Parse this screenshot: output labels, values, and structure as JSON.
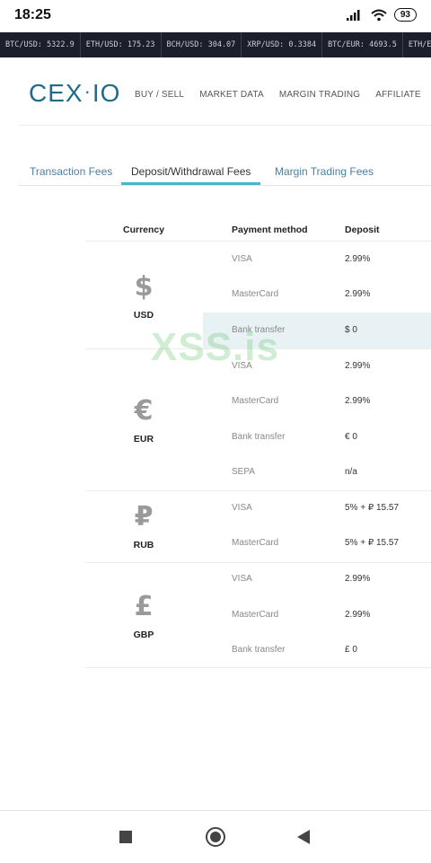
{
  "status_bar": {
    "time": "18:25",
    "battery": "93"
  },
  "ticker": [
    "BTC/USD: 5322.9",
    "ETH/USD: 175.23",
    "BCH/USD: 304.07",
    "XRP/USD: 0.3384",
    "BTC/EUR: 4693.5",
    "ETH/EUR"
  ],
  "header": {
    "logo_left": "CEX",
    "logo_dot": "·",
    "logo_right": "IO",
    "nav": [
      "BUY / SELL",
      "MARKET DATA",
      "MARGIN TRADING",
      "AFFILIATE"
    ]
  },
  "tabs": [
    "Transaction Fees",
    "Deposit/Withdrawal Fees",
    "Margin Trading Fees"
  ],
  "table": {
    "headers": {
      "currency": "Currency",
      "method": "Payment method",
      "deposit": "Deposit"
    },
    "groups": [
      {
        "symbol": "$",
        "code": "USD",
        "rows": [
          {
            "method": "VISA",
            "deposit": "2.99%"
          },
          {
            "method": "MasterCard",
            "deposit": "2.99%"
          },
          {
            "method": "Bank transfer",
            "deposit": "$ 0"
          }
        ]
      },
      {
        "symbol": "€",
        "code": "EUR",
        "rows": [
          {
            "method": "VISA",
            "deposit": "2.99%"
          },
          {
            "method": "MasterCard",
            "deposit": "2.99%"
          },
          {
            "method": "Bank transfer",
            "deposit": "€ 0"
          },
          {
            "method": "SEPA",
            "deposit": "n/a"
          }
        ]
      },
      {
        "symbol": "₽",
        "code": "RUB",
        "rows": [
          {
            "method": "VISA",
            "deposit": "5% + ₽ 15.57"
          },
          {
            "method": "MasterCard",
            "deposit": "5% + ₽ 15.57"
          }
        ]
      },
      {
        "symbol": "£",
        "code": "GBP",
        "rows": [
          {
            "method": "VISA",
            "deposit": "2.99%"
          },
          {
            "method": "MasterCard",
            "deposit": "2.99%"
          },
          {
            "method": "Bank transfer",
            "deposit": "£ 0"
          }
        ]
      }
    ]
  },
  "watermark": "XSS.is"
}
